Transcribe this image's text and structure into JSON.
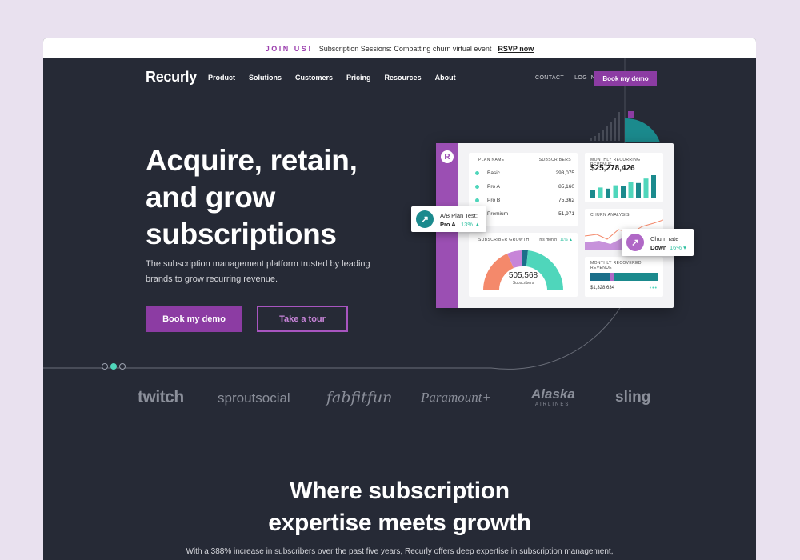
{
  "banner": {
    "join_label": "JOIN US!",
    "event_text": "Subscription Sessions: Combatting churn virtual event",
    "rsvp_label": "RSVP now"
  },
  "nav": {
    "logo": "Recurly",
    "links": [
      "Product",
      "Solutions",
      "Customers",
      "Pricing",
      "Resources",
      "About"
    ],
    "contact": "CONTACT",
    "login": "LOG IN",
    "cta": "Book my demo"
  },
  "hero": {
    "title_lines": [
      "Acquire, retain,",
      "and grow",
      "subscriptions"
    ],
    "subtitle_lines": [
      "The subscription management platform trusted by leading",
      "brands to grow recurring revenue."
    ],
    "primary_cta": "Book my demo",
    "secondary_cta": "Take a tour"
  },
  "dashboard": {
    "logo_letter": "R",
    "plans": {
      "header_name": "PLAN NAME",
      "header_subs": "SUBSCRIBERS",
      "rows": [
        {
          "name": "Basic",
          "value": "293,075"
        },
        {
          "name": "Pro A",
          "value": "85,160"
        },
        {
          "name": "Pro B",
          "value": "75,362"
        },
        {
          "name": "Premium",
          "value": "51,971"
        }
      ]
    },
    "mrr": {
      "title": "MONTHLY RECURRING REVENUE",
      "value": "$25,278,426",
      "bar_heights": [
        0.35,
        0.45,
        0.4,
        0.55,
        0.5,
        0.7,
        0.65,
        0.85,
        1.0
      ]
    },
    "churn_analysis": {
      "title": "CHURN ANALYSIS"
    },
    "growth": {
      "title": "SUBSCRIBER GROWTH",
      "this_month_label": "This month",
      "this_month_value": "11% ▲",
      "total": "505,568",
      "total_label": "Subscribers"
    },
    "recovered": {
      "title": "MONTHLY RECOVERED REVENUE",
      "value": "$1,328,634"
    },
    "ab_popup": {
      "title": "A/B Plan Test:",
      "plan": "Pro A",
      "change": "13% ▲"
    },
    "churn_popup": {
      "title": "Churn rate",
      "direction": "Down",
      "change": "16% ▾"
    }
  },
  "carousel": {
    "count": 3,
    "active": 1
  },
  "customer_logos": [
    "twitch",
    "sproutsocial",
    "fabfitfun",
    "Paramount+",
    "Alaska",
    "AIRLINES",
    "sling"
  ],
  "section": {
    "title_lines": [
      "Where subscription",
      "expertise meets growth"
    ],
    "subtitle": "With a 388% increase in subscribers over the past five years, Recurly offers deep expertise in subscription management,"
  },
  "colors": {
    "brand_purple": "#8c3ca3",
    "accent_teal": "#4fd6bb",
    "background": "#262a36",
    "coral": "#f4896b"
  }
}
